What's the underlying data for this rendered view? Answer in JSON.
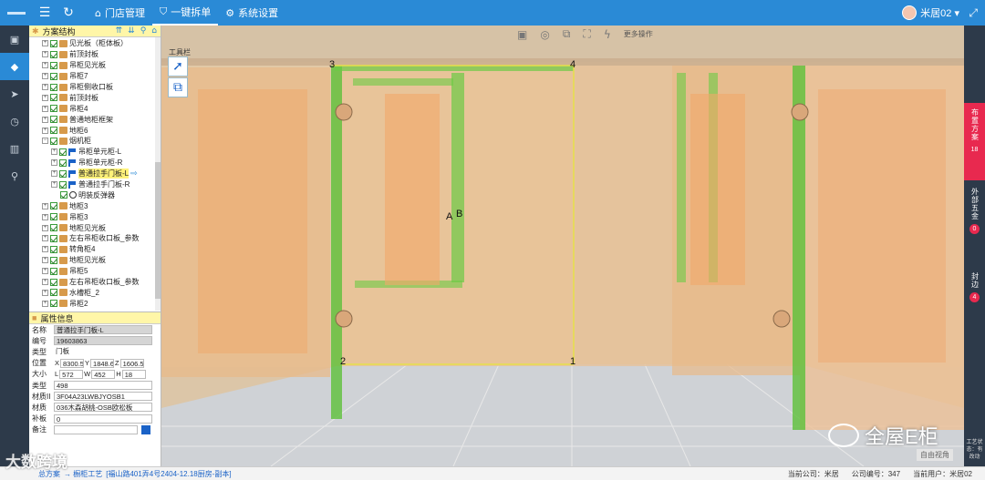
{
  "topbar": {
    "menu": [
      {
        "icon": "home-icon",
        "glyph": "⌂",
        "label": "门店管理"
      },
      {
        "icon": "shield-icon",
        "glyph": "⛉",
        "label": "一键拆单"
      },
      {
        "icon": "gear-icon",
        "glyph": "⚙",
        "label": "系统设置"
      }
    ],
    "user": "米居02 ▾",
    "colors": {
      "bar": "#2a8ad6",
      "nav": "#2d3a4a",
      "accent": "#e8294f"
    }
  },
  "tree": {
    "title": "方案结构",
    "items": [
      {
        "label": "见光板（柜体板）",
        "icon": "cabinet",
        "level": 0
      },
      {
        "label": "前顶封板",
        "icon": "cabinet",
        "level": 0
      },
      {
        "label": "吊柜见光板",
        "icon": "cabinet",
        "level": 0
      },
      {
        "label": "吊柜7",
        "icon": "cabinet",
        "level": 0
      },
      {
        "label": "吊柜侧收口板",
        "icon": "cabinet",
        "level": 0
      },
      {
        "label": "前顶封板",
        "icon": "cabinet",
        "level": 0
      },
      {
        "label": "吊柜4",
        "icon": "cabinet",
        "level": 0
      },
      {
        "label": "普通地柜框架",
        "icon": "cabinet",
        "level": 0
      },
      {
        "label": "地柜6",
        "icon": "cabinet",
        "level": 0
      },
      {
        "label": "烟机柜",
        "icon": "cabinet",
        "level": 0,
        "expanded": true
      },
      {
        "label": "吊柜单元柜-L",
        "icon": "flag",
        "level": 1
      },
      {
        "label": "吊柜单元柜-R",
        "icon": "flag",
        "level": 1
      },
      {
        "label": "普通拉手门板-L",
        "icon": "flag",
        "level": 1,
        "selected": true
      },
      {
        "label": "普通拉手门板-R",
        "icon": "flag",
        "level": 1
      },
      {
        "label": "明装反弹器",
        "icon": "circle",
        "level": 2
      },
      {
        "label": "地柜3",
        "icon": "cabinet",
        "level": 0
      },
      {
        "label": "吊柜3",
        "icon": "cabinet",
        "level": 0
      },
      {
        "label": "地柜见光板",
        "icon": "cabinet",
        "level": 0
      },
      {
        "label": "左右吊柜收口板_参数",
        "icon": "cabinet",
        "level": 0
      },
      {
        "label": "转角柜4",
        "icon": "cabinet",
        "level": 0
      },
      {
        "label": "地柜见光板",
        "icon": "cabinet",
        "level": 0
      },
      {
        "label": "吊柜5",
        "icon": "cabinet",
        "level": 0
      },
      {
        "label": "左右吊柜收口板_参数",
        "icon": "cabinet",
        "level": 0
      },
      {
        "label": "水槽柜_2",
        "icon": "cabinet",
        "level": 0
      },
      {
        "label": "吊柜2",
        "icon": "cabinet",
        "level": 0
      }
    ]
  },
  "props": {
    "title": "属性信息",
    "name_label": "名称",
    "name": "普通拉手门板-L",
    "code_label": "编号",
    "code": "19603863",
    "type_label": "类型",
    "type": "门板",
    "pos_label": "位置",
    "pos_x": "8300.5",
    "pos_y": "1848.6",
    "pos_z": "1606.5",
    "size_label": "大小",
    "size_l": "572",
    "size_w": "452",
    "size_h": "18",
    "kind_label": "类型",
    "kind": "498",
    "matcode_label": "材质II",
    "matcode": "3F04A23LWBJYOSB1",
    "mat_label": "材质",
    "mat": "036木森胡桃-OSB欧松板",
    "pad_label": "补板",
    "pad": "0",
    "note_label": "备注",
    "note": ""
  },
  "viewport": {
    "toolbar_more": "更多操作",
    "tool_title": "工具栏",
    "markers": [
      "1",
      "2",
      "3",
      "4",
      "A",
      "B"
    ],
    "view_mode": "自由视角"
  },
  "rightbar": {
    "tabs": [
      {
        "label": "布置方案",
        "count": "18"
      },
      {
        "label": "外部五金",
        "count": "0"
      },
      {
        "label": "封边",
        "count": "4"
      }
    ],
    "footer": "工艺状态：有改动"
  },
  "status": {
    "left_1": "总方案",
    "left_2": "→ 橱柜工艺",
    "left_3": "[福山路401弄4号2404-12.18厨房-副本]",
    "company": "当前公司：米居",
    "company_code": "公司编号：347",
    "current_user": "当前用户：米居02"
  },
  "watermarks": {
    "left": "大数跨境",
    "right": "全屋E柜"
  }
}
